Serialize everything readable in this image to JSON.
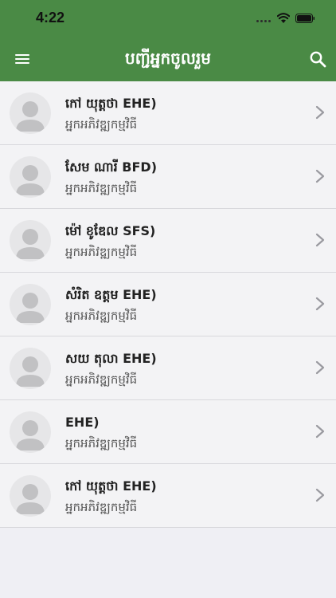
{
  "status_bar": {
    "time": "4:22",
    "wifi_icon": "wifi-icon",
    "battery_icon": "battery-icon",
    "signal_icon": "signal-dots-icon"
  },
  "header": {
    "title": "បញ្ជីអ្នកចូលរួម",
    "menu_icon": "menu-icon",
    "search_icon": "search-icon",
    "background_color": "#4a8a45"
  },
  "participants": [
    {
      "name": "កៅ យុត្តថា EHE)",
      "role": "អ្នកអភិវឌ្ឍកម្មវិធី"
    },
    {
      "name": "សែម ណារី BFD)",
      "role": "អ្នកអភិវឌ្ឍកម្មវិធី"
    },
    {
      "name": "ម៉ៅ ខូឌែល SFS)",
      "role": "អ្នកអភិវឌ្ឍកម្មវិធី"
    },
    {
      "name": "សំរិត ឧត្តម EHE)",
      "role": "អ្នកអភិវឌ្ឍកម្មវិធី"
    },
    {
      "name": "សយ តុលា EHE)",
      "role": "អ្នកអភិវឌ្ឍកម្មវិធី"
    },
    {
      "name": " EHE)",
      "role": "អ្នកអភិវឌ្ឍកម្មវិធី"
    },
    {
      "name": "កៅ យុត្តថា EHE)",
      "role": "អ្នកអភិវឌ្ឍកម្មវិធី"
    }
  ]
}
